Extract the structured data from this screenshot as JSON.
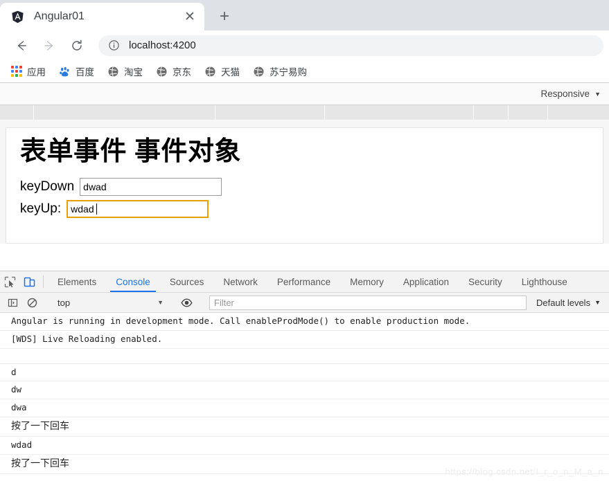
{
  "browser": {
    "tab": {
      "title": "Angular01",
      "favicon": "angular-logo-icon",
      "close_label": "✕"
    },
    "new_tab_label": "+",
    "nav": {
      "back": "back-arrow-icon",
      "forward": "forward-arrow-icon",
      "reload": "reload-icon"
    },
    "omnibox": {
      "url": "localhost:4200",
      "info_icon": "info-circle-icon"
    },
    "bookmarks": [
      {
        "label": "应用",
        "icon": "apps-grid-icon"
      },
      {
        "label": "百度",
        "icon": "baidu-paw-icon"
      },
      {
        "label": "淘宝",
        "icon": "globe-icon"
      },
      {
        "label": "京东",
        "icon": "globe-icon"
      },
      {
        "label": "天猫",
        "icon": "globe-icon"
      },
      {
        "label": "苏宁易购",
        "icon": "globe-icon"
      }
    ]
  },
  "device_toolbar": {
    "preset_label": "Responsive",
    "caret": "▼"
  },
  "page": {
    "heading": "表单事件 事件对象",
    "fields": [
      {
        "label": "keyDown",
        "value": "dwad",
        "focused": false
      },
      {
        "label": "keyUp:",
        "value": "wdad",
        "focused": true
      }
    ]
  },
  "devtools": {
    "inspect_icon": "inspect-element-icon",
    "device_toggle_icon": "device-toolbar-icon",
    "tabs": [
      {
        "label": "Elements",
        "active": false
      },
      {
        "label": "Console",
        "active": true
      },
      {
        "label": "Sources",
        "active": false
      },
      {
        "label": "Network",
        "active": false
      },
      {
        "label": "Performance",
        "active": false
      },
      {
        "label": "Memory",
        "active": false
      },
      {
        "label": "Application",
        "active": false
      },
      {
        "label": "Security",
        "active": false
      },
      {
        "label": "Lighthouse",
        "active": false
      }
    ],
    "console_toolbar": {
      "sidebar_icon": "console-sidebar-icon",
      "clear_icon": "clear-console-icon",
      "context": "top",
      "context_caret": "▼",
      "eye_icon": "live-expression-eye-icon",
      "filter_placeholder": "Filter",
      "filter_value": "",
      "levels_label": "Default levels",
      "levels_caret": "▼"
    },
    "messages": [
      {
        "text": "Angular is running in development mode. Call enableProdMode() to enable production mode.",
        "cjk": false
      },
      {
        "text": "[WDS] Live Reloading enabled.",
        "cjk": false
      },
      {
        "text": "",
        "gap": true
      },
      {
        "text": "d",
        "cjk": false
      },
      {
        "text": "dw",
        "cjk": false
      },
      {
        "text": "dwa",
        "cjk": false
      },
      {
        "text": "按了一下回车",
        "cjk": true
      },
      {
        "text": "wdad",
        "cjk": false
      },
      {
        "text": "按了一下回车",
        "cjk": true
      }
    ],
    "watermark": "https://blog.csdn.net/I_r_o_n_M_a_n"
  },
  "colors": {
    "accent": "#1a73e8",
    "focus_border": "#e8a000",
    "chrome_bg": "#dee1e6"
  }
}
